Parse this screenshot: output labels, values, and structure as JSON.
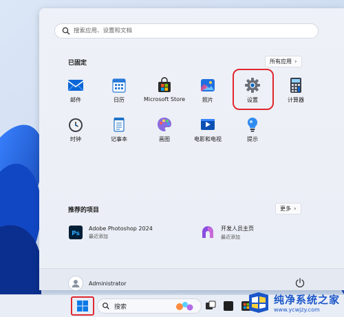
{
  "search": {
    "placeholder": "搜索应用、设置和文档"
  },
  "pinned": {
    "title": "已固定",
    "all_apps_label": "所有应用",
    "apps": [
      {
        "label": "邮件",
        "icon": "mail-icon"
      },
      {
        "label": "日历",
        "icon": "calendar-icon"
      },
      {
        "label": "Microsoft Store",
        "icon": "store-icon"
      },
      {
        "label": "照片",
        "icon": "photos-icon"
      },
      {
        "label": "设置",
        "icon": "gear-icon"
      },
      {
        "label": "计算器",
        "icon": "calculator-icon"
      },
      {
        "label": "时钟",
        "icon": "clock-icon"
      },
      {
        "label": "记事本",
        "icon": "notepad-icon"
      },
      {
        "label": "画图",
        "icon": "paint-icon"
      },
      {
        "label": "电影和电视",
        "icon": "movies-tv-icon"
      },
      {
        "label": "提示",
        "icon": "tips-icon"
      }
    ]
  },
  "recommended": {
    "title": "推荐的项目",
    "more_label": "更多",
    "items": [
      {
        "name": "Adobe Photoshop 2024",
        "sub": "最近添加",
        "icon": "photoshop-icon"
      },
      {
        "name": "开发人员主页",
        "sub": "最近添加",
        "icon": "dev-home-icon"
      }
    ]
  },
  "user": {
    "name": "Administrator"
  },
  "taskbar": {
    "search_label": "搜索"
  },
  "watermark": {
    "main": "纯净系统之家",
    "url": "www.ycwjzy.com"
  },
  "colors": {
    "accent": "#0067c0",
    "highlight": "#e0262e",
    "watermark": "#1b56c9"
  }
}
